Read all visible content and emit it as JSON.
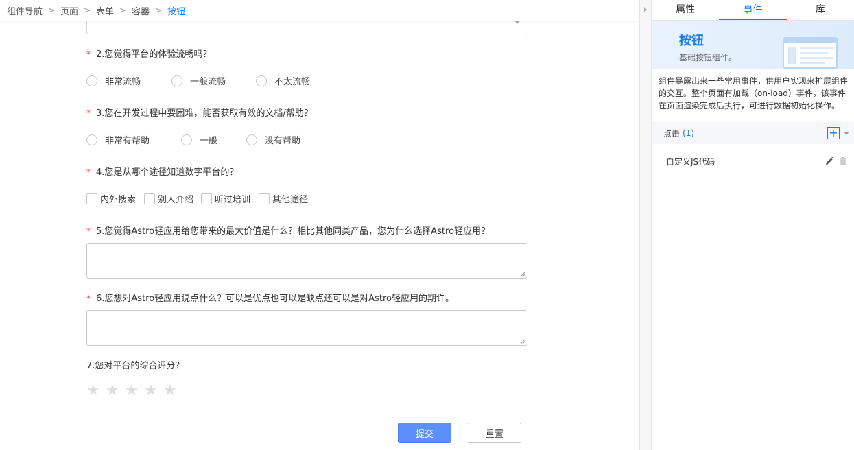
{
  "breadcrumb": {
    "items": [
      "组件导航",
      "页面",
      "表单",
      "容器",
      "按钮"
    ]
  },
  "form": {
    "q2": {
      "required": "*",
      "label": "2.您觉得平台的体验流畅吗？",
      "options": [
        "非常流畅",
        "一般流畅",
        "不太流畅"
      ]
    },
    "q3": {
      "required": "*",
      "label": "3.您在开发过程中要困难，能否获取有效的文档/帮助？",
      "options": [
        "非常有帮助",
        "一般",
        "没有帮助"
      ]
    },
    "q4": {
      "required": "*",
      "label": "4.您是从哪个途径知道数字平台的？",
      "options": [
        "内外搜索",
        "别人介绍",
        "听过培训",
        "其他途径"
      ]
    },
    "q5": {
      "required": "*",
      "label": "5.您觉得Astro轻应用给您带来的最大价值是什么？相比其他同类产品，您为什么选择Astro轻应用？"
    },
    "q6": {
      "required": "*",
      "label": "6.您想对Astro轻应用说点什么？可以是优点也可以是缺点还可以是对Astro轻应用的期许。"
    },
    "q7": {
      "label": "7.您对平台的综合评分？",
      "rating": 0,
      "max_rating": 5
    },
    "submit_label": "提交",
    "reset_label": "重置"
  },
  "panel": {
    "tabs": [
      "属性",
      "事件",
      "库"
    ],
    "active_tab": 1,
    "banner": {
      "title": "按钮",
      "subtitle": "基础按钮组件。"
    },
    "description": "组件暴露出来一些常用事件，供用户实现来扩展组件的交互。整个页面有加载（on-load）事件，该事件在页面渲染完成后执行，可进行数据初始化操作。",
    "event": {
      "name": "点击",
      "count": "(1)"
    },
    "handler": {
      "label": "自定义JS代码"
    }
  },
  "colors": {
    "accent": "#1b7ce6",
    "submit": "#5b8ff9",
    "required": "#e53935"
  }
}
